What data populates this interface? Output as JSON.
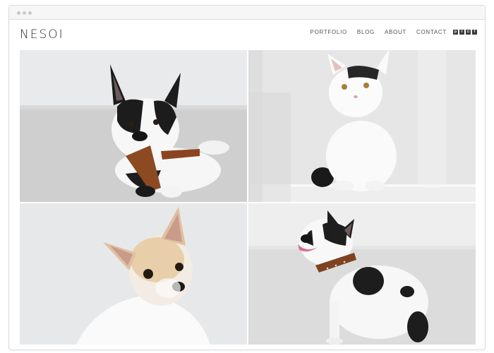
{
  "brand": {
    "name": "NESOI"
  },
  "nav": {
    "items": [
      {
        "label": "PORTFOLIO"
      },
      {
        "label": "BLOG"
      },
      {
        "label": "ABOUT"
      },
      {
        "label": "CONTACT"
      }
    ],
    "social": [
      {
        "icon": "pinterest-icon",
        "glyph": "p"
      },
      {
        "icon": "twitter-icon",
        "glyph": "t"
      },
      {
        "icon": "instagram-icon",
        "glyph": "◘"
      },
      {
        "icon": "facebook-icon",
        "glyph": "f"
      }
    ]
  },
  "gallery": {
    "photos": [
      {
        "subject": "french-bulldog-chewing-stick"
      },
      {
        "subject": "white-kitten-sitting"
      },
      {
        "subject": "chihuahua-portrait"
      },
      {
        "subject": "french-bulldog-sitting"
      }
    ]
  },
  "colors": {
    "logo": "#2b2b2b",
    "nav_text": "#555555",
    "social_bg": "#3a3a3a"
  }
}
